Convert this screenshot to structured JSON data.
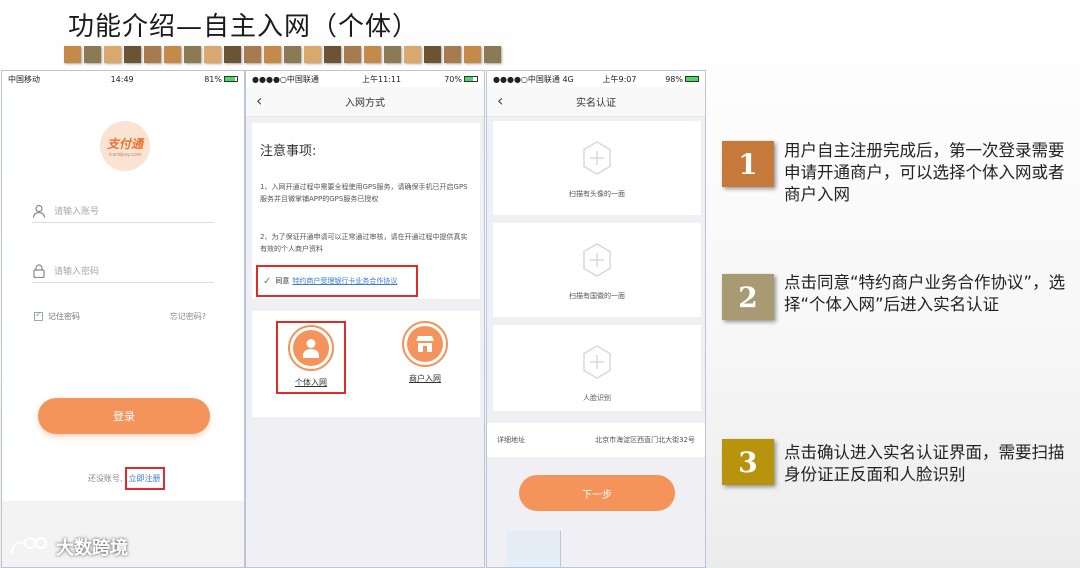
{
  "slide": {
    "title": "功能介绍—自主入网（个体）",
    "deco_colors": [
      "#c58a4a",
      "#8c7a55",
      "#d9a86c",
      "#6b5434",
      "#a67c4e",
      "#c58a4a",
      "#8c7a55",
      "#d9a86c",
      "#6b5434",
      "#a67c4e",
      "#c58a4a",
      "#8c7a55",
      "#d9a86c",
      "#6b5434",
      "#a67c4e",
      "#c58a4a",
      "#8c7a55",
      "#d9a86c",
      "#6b5434",
      "#a67c4e",
      "#c58a4a",
      "#8c7a55"
    ]
  },
  "phone1": {
    "status": {
      "carrier": "中国移动",
      "time": "14:49",
      "battery": "81%"
    },
    "logo": {
      "main": "支付通",
      "sub": "icardpay.com"
    },
    "account_placeholder": "请输入账号",
    "password_placeholder": "请输入密码",
    "remember_label": "记住密码",
    "forgot_label": "忘记密码?",
    "login_button": "登录",
    "no_account_text": "还没账号,",
    "register_link": "立即注册"
  },
  "phone2": {
    "status": {
      "carrier": "●●●●○中国联通",
      "time": "上午11:11",
      "battery": "70%"
    },
    "nav_title": "入网方式",
    "notice_title": "注意事项:",
    "notice_1": "1、入网开通过程中需要全程使用GPS服务，请确保手机已开启GPS服务并且微掌铺APP的GPS服务已授权",
    "notice_2": "2、为了保证开通申请可以正常通过审核，请在开通过程中提供真实有效的个人商户资料",
    "agree_label": "同意",
    "agreement_link": "特约商户受理银行卡业务合作协议",
    "option_individual": "个体入网",
    "option_merchant": "商户入网"
  },
  "phone3": {
    "status": {
      "carrier": "●●●●○中国联通",
      "network": "4G",
      "time": "上午9:07",
      "battery": "98%"
    },
    "nav_title": "实名认证",
    "scan_front": "扫描有头像的一面",
    "scan_back": "扫描有国徽的一面",
    "face_recognition": "人脸识别",
    "address_label": "详细地址",
    "address_value": "北京市海淀区西直门北大街32号",
    "next_button": "下一步"
  },
  "steps": [
    {
      "num": "1",
      "text": "用户自主注册完成后，第一次登录需要申请开通商户，可以选择个体入网或者商户入网",
      "color": "#c57a3c"
    },
    {
      "num": "2",
      "text": "点击同意“特约商户业务合作协议”，选择“个体入网”后进入实名认证",
      "color": "#a89a72"
    },
    {
      "num": "3",
      "text": "点击确认进入实名认证界面，需要扫描身份证正反面和人脸识别",
      "color": "#b8930e"
    }
  ],
  "watermark": "大数跨境"
}
